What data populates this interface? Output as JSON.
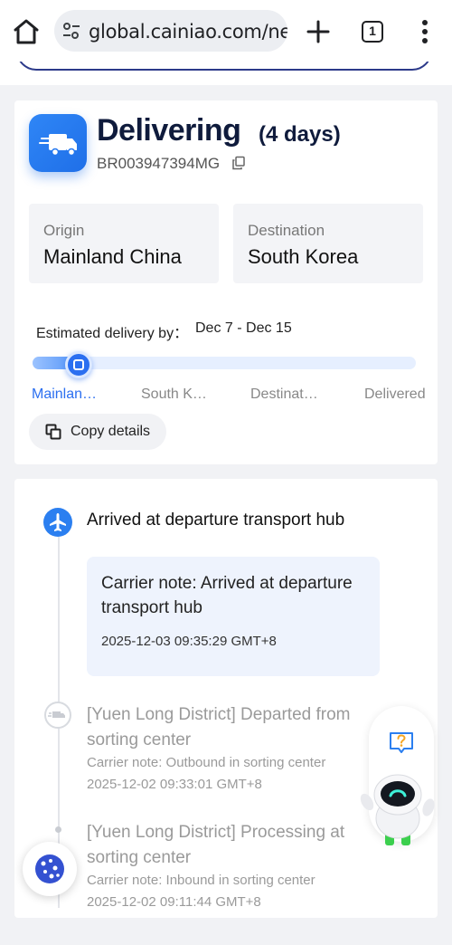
{
  "browser": {
    "url": "global.cainiao.com/ne",
    "tab_count": "1",
    "icons": {
      "home": "home-icon",
      "site_info": "site-settings-icon",
      "new_tab": "plus-icon",
      "tabs": "tab-switcher-icon",
      "menu": "more-vert-icon"
    }
  },
  "shipment": {
    "status": "Delivering",
    "duration": "(4 days)",
    "tracking_number": "BR003947394MG",
    "origin_label": "Origin",
    "origin_value": "Mainland China",
    "destination_label": "Destination",
    "destination_value": "South Korea",
    "eta_label": "Estimated delivery by：",
    "eta_value": "Dec 7 - Dec 15",
    "progress_fraction": 0.12,
    "steps": [
      "Mainlan…",
      "South K…",
      "Destinat…",
      "Delivered"
    ],
    "active_step": 0,
    "copy_label": "Copy details",
    "accent_color": "#2b6ff0"
  },
  "timeline": {
    "events": [
      {
        "title": "Arrived at departure transport hub",
        "note": "Carrier note: Arrived at departure transport hub",
        "time": "2025-12-03 09:35:29 GMT+8",
        "icon": "airplane-icon"
      },
      {
        "title": "[Yuen Long District] Departed from sorting center",
        "note": "Carrier note: Outbound in sorting center",
        "time": "2025-12-02 09:33:01 GMT+8",
        "icon": "truck-icon"
      },
      {
        "title": "[Yuen Long District] Processing at sorting center",
        "note": "Carrier note: Inbound in sorting center",
        "time": "2025-12-02 09:11:44 GMT+8",
        "icon": "dot-icon"
      }
    ]
  },
  "floating": {
    "cookie_icon": "cookie-icon",
    "help_icon": "help-chat-icon",
    "assistant_icon": "robot-assistant-icon"
  }
}
